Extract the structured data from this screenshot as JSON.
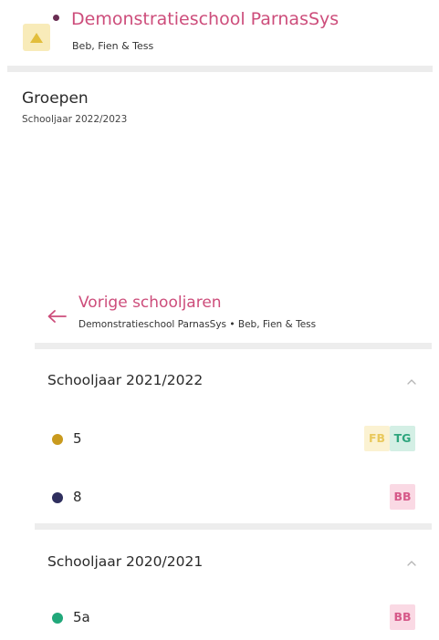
{
  "header": {
    "school_name": "Demonstratieschool ParnasSys",
    "team": "Beb, Fien & Tess",
    "logo_color": "#f8ebb9",
    "dot_color": "#6a2e53"
  },
  "groups": {
    "title": "Groepen",
    "school_year": "Schooljaar 2022/2023"
  },
  "previous_years": {
    "title": "Vorige schooljaren",
    "subtitle": "Demonstratieschool ParnasSys • Beb, Fien & Tess",
    "back_icon": "arrow-left-icon",
    "years": [
      {
        "label": "Schooljaar 2021/2022",
        "expanded": true,
        "groups": [
          {
            "name": "5",
            "dot_color": "#c99a1e",
            "badges": [
              {
                "text": "FB",
                "bg": "#fbf2d2",
                "fg": "#e9c95c"
              },
              {
                "text": "TG",
                "bg": "#d4efe5",
                "fg": "#2da57d"
              }
            ]
          },
          {
            "name": "8",
            "dot_color": "#2f2f5e",
            "badges": [
              {
                "text": "BB",
                "bg": "#fad9e4",
                "fg": "#d65989"
              }
            ]
          }
        ]
      },
      {
        "label": "Schooljaar 2020/2021",
        "expanded": true,
        "groups": [
          {
            "name": "5a",
            "dot_color": "#21a87a",
            "badges": [
              {
                "text": "BB",
                "bg": "#fad9e4",
                "fg": "#d65989"
              }
            ]
          }
        ]
      }
    ]
  }
}
